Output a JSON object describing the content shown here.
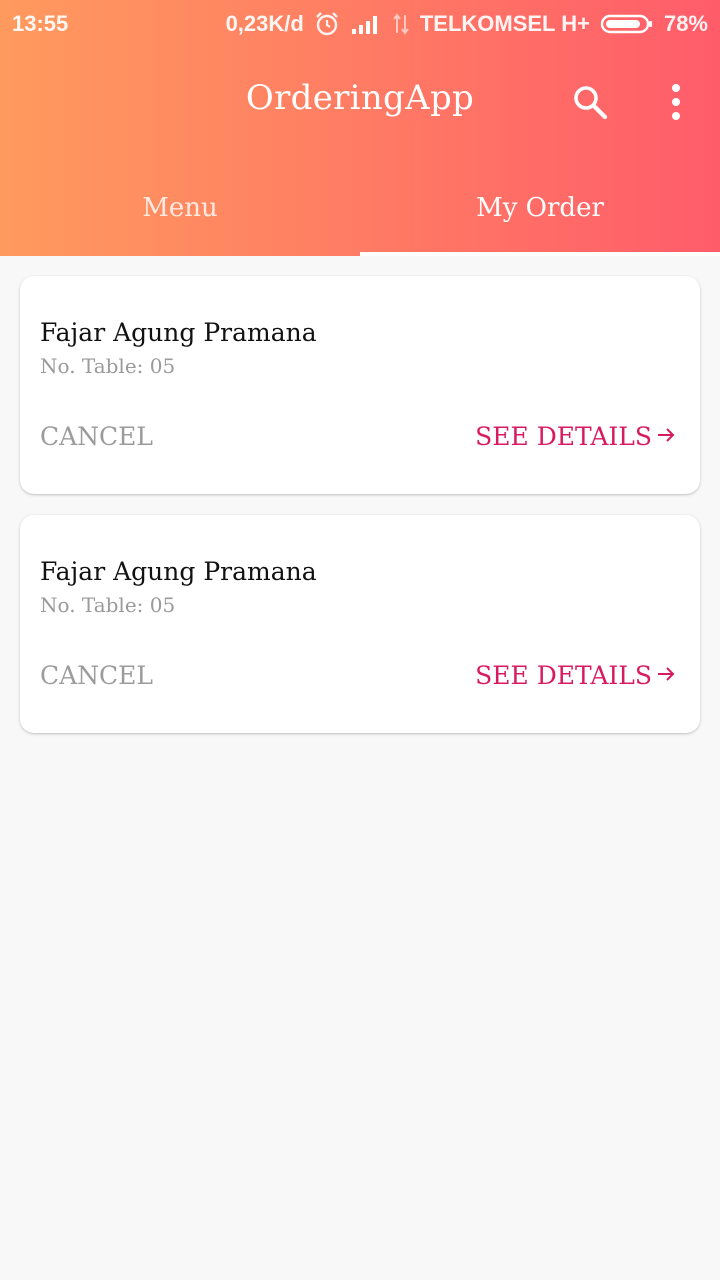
{
  "status_bar": {
    "time": "13:55",
    "data_rate": "0,23K/d",
    "carrier": "TELKOMSEL H+",
    "battery": "78%",
    "icons": [
      "alarm-icon",
      "signal-icon",
      "data-arrows-icon",
      "battery-icon"
    ]
  },
  "toolbar": {
    "title": "OrderingApp",
    "icons": [
      "search-icon",
      "more-vert-icon"
    ]
  },
  "tabs": [
    {
      "label": "Menu",
      "active": false
    },
    {
      "label": "My Order",
      "active": true
    }
  ],
  "orders": [
    {
      "name": "Fajar Agung Pramana",
      "table": "No. Table: 05",
      "cancel_label": "CANCEL",
      "details_label": "SEE DETAILS"
    },
    {
      "name": "Fajar Agung Pramana",
      "table": "No. Table: 05",
      "cancel_label": "CANCEL",
      "details_label": "SEE DETAILS"
    }
  ],
  "colors": {
    "header_gradient_start": "#ff9a5e",
    "header_gradient_end": "#ff5c6a",
    "accent": "#d81b60",
    "background": "#f8f8f8"
  }
}
